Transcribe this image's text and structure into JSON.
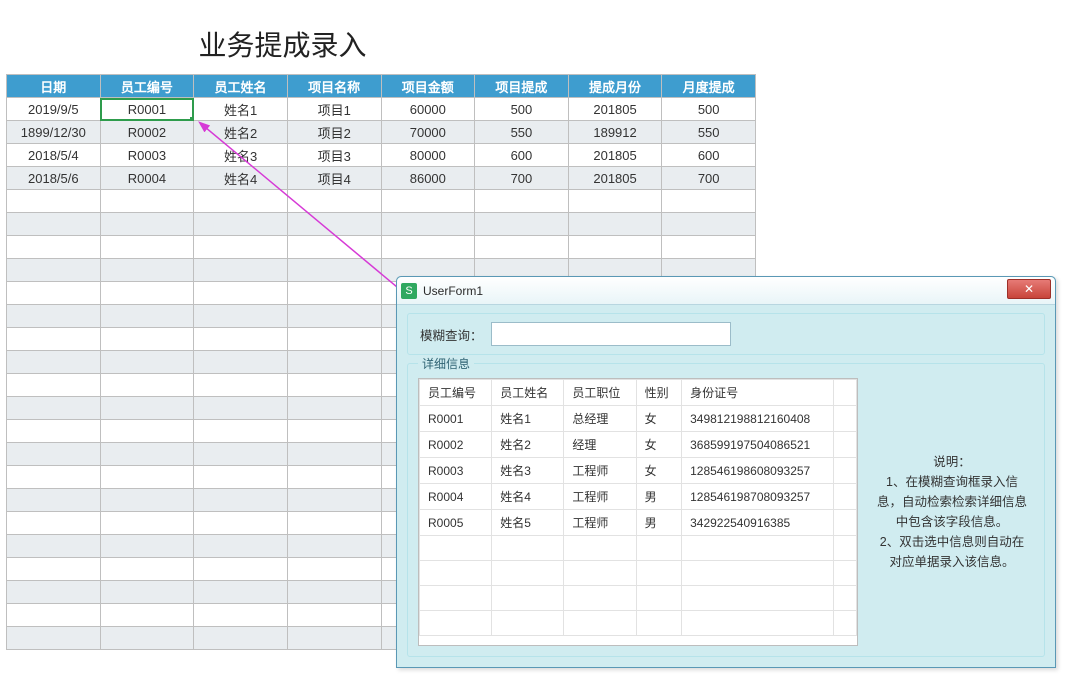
{
  "title": "业务提成录入",
  "sheet": {
    "columns": [
      "日期",
      "员工编号",
      "员工姓名",
      "项目名称",
      "项目金额",
      "项目提成",
      "提成月份",
      "月度提成"
    ],
    "rows": [
      {
        "c": [
          "2019/9/5",
          "R0001",
          "姓名1",
          "项目1",
          "60000",
          "500",
          "201805",
          "500"
        ]
      },
      {
        "c": [
          "1899/12/30",
          "R0002",
          "姓名2",
          "项目2",
          "70000",
          "550",
          "189912",
          "550"
        ]
      },
      {
        "c": [
          "2018/5/4",
          "R0003",
          "姓名3",
          "项目3",
          "80000",
          "600",
          "201805",
          "600"
        ]
      },
      {
        "c": [
          "2018/5/6",
          "R0004",
          "姓名4",
          "项目4",
          "86000",
          "700",
          "201805",
          "700"
        ]
      }
    ],
    "blank_rows": 20,
    "selected": {
      "row": 0,
      "col": 1
    }
  },
  "form": {
    "window_title": "UserForm1",
    "search_label": "模糊查询：",
    "search_value": "",
    "detail_label": "详细信息",
    "note_title": "说明：",
    "note_lines": [
      "1、在模糊查询框录入信息，自动检索检索详细信息中包含该字段信息。",
      "2、双击选中信息则自动在对应单据录入该信息。"
    ],
    "emp_columns": [
      "员工编号",
      "员工姓名",
      "员工职位",
      "性别",
      "身份证号"
    ],
    "emp_rows": [
      [
        "R0001",
        "姓名1",
        "总经理",
        "女",
        "349812198812160408"
      ],
      [
        "R0002",
        "姓名2",
        "经理",
        "女",
        "368599197504086521"
      ],
      [
        "R0003",
        "姓名3",
        "工程师",
        "女",
        "128546198608093257"
      ],
      [
        "R0004",
        "姓名4",
        "工程师",
        "男",
        "128546198708093257"
      ],
      [
        "R0005",
        "姓名5",
        "工程师",
        "男",
        "342922540916385"
      ]
    ],
    "emp_blank_rows": 4
  }
}
